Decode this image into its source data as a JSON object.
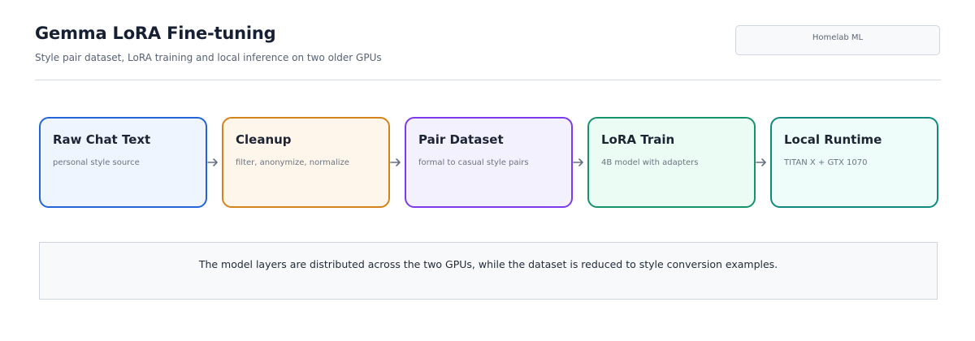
{
  "header": {
    "title": "Gemma LoRA Fine-tuning",
    "subtitle": "Style pair dataset, LoRA training and local inference on two older GPUs",
    "badge": "Homelab ML"
  },
  "pipeline": [
    {
      "title": "Raw Chat Text",
      "subtitle": "personal style source",
      "border": "#2563d9",
      "fill": "#eff5fe"
    },
    {
      "title": "Cleanup",
      "subtitle": "filter, anonymize, normalize",
      "border": "#d4821a",
      "fill": "#fff6eb"
    },
    {
      "title": "Pair Dataset",
      "subtitle": "formal to casual style pairs",
      "border": "#7c3aed",
      "fill": "#f4f1fe"
    },
    {
      "title": "LoRA Train",
      "subtitle": "4B model with adapters",
      "border": "#15936a",
      "fill": "#ebfcf4"
    },
    {
      "title": "Local Runtime",
      "subtitle": "TITAN X + GTX 1070",
      "border": "#118a7d",
      "fill": "#effdfa"
    }
  ],
  "note": {
    "text": "The model layers are distributed across the two GPUs, while the dataset is reduced to style conversion examples."
  },
  "colors": {
    "arrow": "#667085"
  }
}
